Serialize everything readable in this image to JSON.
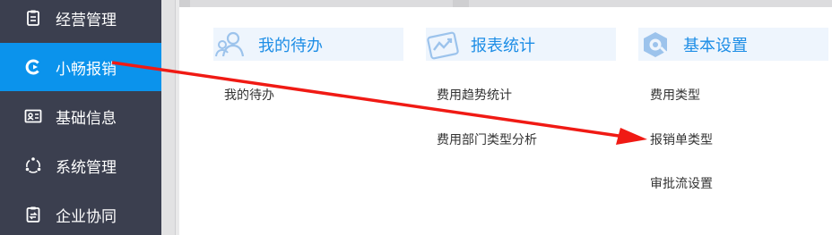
{
  "sidebar": {
    "items": [
      {
        "label": "经营管理",
        "icon": "clipboard-icon"
      },
      {
        "label": "小畅报销",
        "icon": "refresh-c-icon",
        "active": true
      },
      {
        "label": "基础信息",
        "icon": "id-card-icon"
      },
      {
        "label": "系统管理",
        "icon": "network-icon"
      },
      {
        "label": "企业协同",
        "icon": "document-icon"
      }
    ]
  },
  "columns": [
    {
      "title": "我的待办",
      "icon": "users-icon",
      "links": [
        "我的待办"
      ]
    },
    {
      "title": "报表统计",
      "icon": "trend-chart-icon",
      "links": [
        "费用趋势统计",
        "费用部门类型分析"
      ]
    },
    {
      "title": "基本设置",
      "icon": "settings-badge-icon",
      "links": [
        "费用类型",
        "报销单类型",
        "审批流设置"
      ]
    }
  ],
  "colors": {
    "sidebar_bg": "#3b3f4f",
    "active_bg": "#0b93ec",
    "header_bg": "#eef5fd",
    "header_text": "#1e8ee6",
    "annotation_arrow": "#f01a14"
  }
}
